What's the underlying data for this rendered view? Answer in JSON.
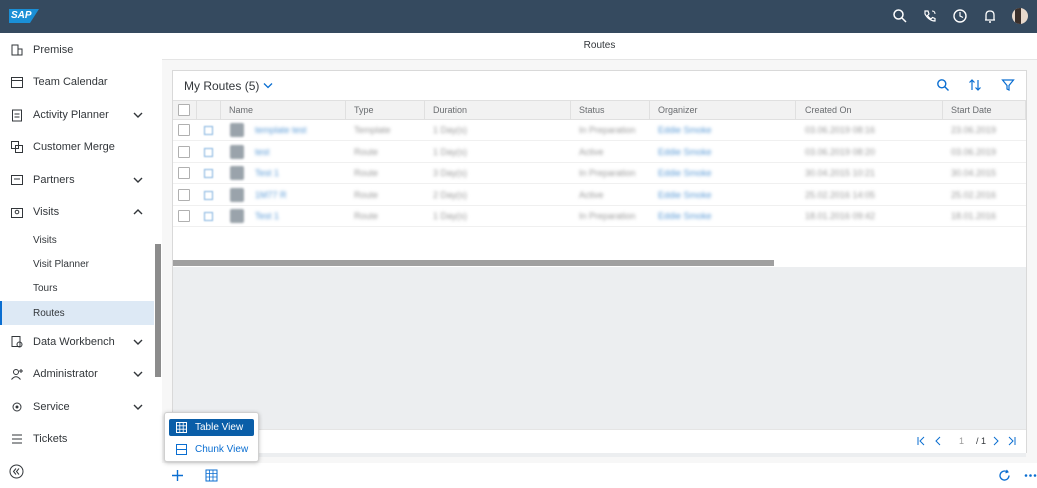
{
  "shell": {
    "logo": "SAP",
    "icons": [
      "search-icon",
      "phone-icon",
      "clock-icon",
      "bell-icon",
      "avatar"
    ]
  },
  "sidebar": {
    "items": [
      {
        "label": "Premise",
        "icon": "premise-icon",
        "chevron": ""
      },
      {
        "label": "Team Calendar",
        "icon": "calendar-icon",
        "chevron": ""
      },
      {
        "label": "Activity Planner",
        "icon": "clipboard-icon",
        "chevron": "down"
      },
      {
        "label": "Customer Merge",
        "icon": "merge-icon",
        "chevron": ""
      },
      {
        "label": "Partners",
        "icon": "partners-icon",
        "chevron": "down"
      },
      {
        "label": "Visits",
        "icon": "visits-icon",
        "chevron": "up"
      }
    ],
    "subitems": [
      {
        "label": "Visits"
      },
      {
        "label": "Visit Planner"
      },
      {
        "label": "Tours"
      },
      {
        "label": "Routes"
      }
    ],
    "items2": [
      {
        "label": "Data Workbench",
        "icon": "workbench-icon",
        "chevron": "down"
      },
      {
        "label": "Administrator",
        "icon": "admin-icon",
        "chevron": "down"
      },
      {
        "label": "Service",
        "icon": "service-icon",
        "chevron": "down"
      },
      {
        "label": "Tickets",
        "icon": "tickets-icon",
        "chevron": ""
      }
    ],
    "collapse_icon": "collapse-icon"
  },
  "page": {
    "title": "Routes"
  },
  "panel": {
    "title": "My Routes",
    "count": "(5)",
    "columns": [
      "Name",
      "Type",
      "Duration",
      "Status",
      "Organizer",
      "Created On",
      "Start Date"
    ],
    "rows": [
      {
        "name": "template test",
        "type": "Template",
        "duration": "1 Day(s)",
        "status": "In Preparation",
        "organizer": "Eddie Smoke",
        "created": "03.06.2019 08:16",
        "start": "23.06.2019"
      },
      {
        "name": "test",
        "type": "Route",
        "duration": "1 Day(s)",
        "status": "Active",
        "organizer": "Eddie Smoke",
        "created": "03.06.2019 08:20",
        "start": "03.06.2019"
      },
      {
        "name": "Test 1",
        "type": "Route",
        "duration": "3 Day(s)",
        "status": "In Preparation",
        "organizer": "Eddie Smoke",
        "created": "30.04.2015 10:21",
        "start": "30.04.2015"
      },
      {
        "name": "1M77 R",
        "type": "Route",
        "duration": "2 Day(s)",
        "status": "Active",
        "organizer": "Eddie Smoke",
        "created": "25.02.2016 14:05",
        "start": "25.02.2016"
      },
      {
        "name": "Test 1",
        "type": "Route",
        "duration": "1 Day(s)",
        "status": "In Preparation",
        "organizer": "Eddie Smoke",
        "created": "18.01.2016 09:42",
        "start": "18.01.2016"
      }
    ],
    "pagination": {
      "page": "1",
      "total": "/ 1"
    }
  },
  "popover": {
    "items": [
      {
        "label": "Table View",
        "icon": "table-view-icon"
      },
      {
        "label": "Chunk View",
        "icon": "chunk-view-icon"
      }
    ]
  },
  "bottom": {
    "icons": [
      "add-icon",
      "table-toggle-icon",
      "refresh-icon",
      "more-icon"
    ]
  }
}
